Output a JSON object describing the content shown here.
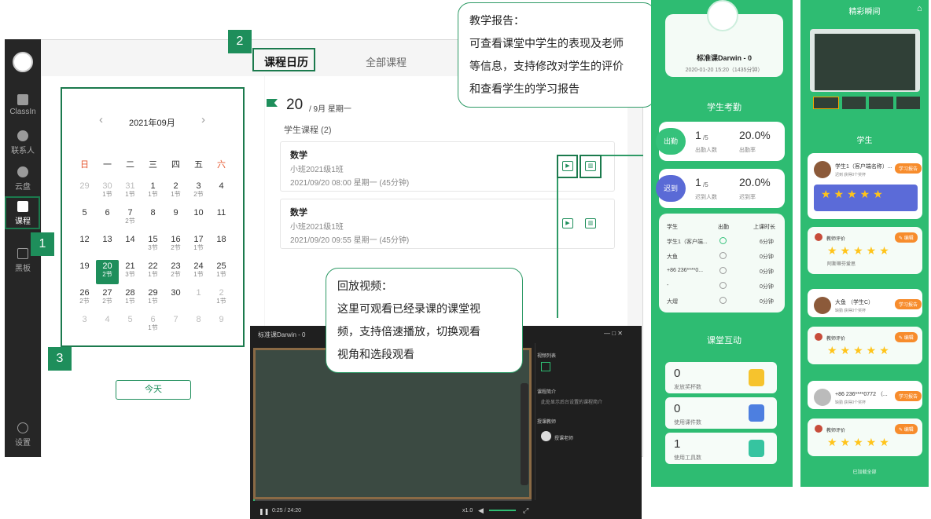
{
  "app": {
    "side": {
      "classin": "ClassIn",
      "contacts": "联系人",
      "cloud": "云盘",
      "course": "课程",
      "board": "黑板",
      "settings": "设置"
    },
    "tabs": {
      "calendar": "课程日历",
      "all": "全部课程"
    },
    "month": "2021年09月",
    "prev": "‹",
    "next": "›",
    "weekdays": [
      "日",
      "一",
      "二",
      "三",
      "四",
      "五",
      "六"
    ],
    "days": [
      [
        {
          "d": "29",
          "s": "",
          "m": true
        },
        {
          "d": "30",
          "s": "1节",
          "m": true
        },
        {
          "d": "31",
          "s": "1节",
          "m": true
        },
        {
          "d": "1",
          "s": "1节"
        },
        {
          "d": "2",
          "s": "1节"
        },
        {
          "d": "3",
          "s": "2节"
        },
        {
          "d": "4",
          "s": ""
        }
      ],
      [
        {
          "d": "5",
          "s": ""
        },
        {
          "d": "6",
          "s": ""
        },
        {
          "d": "7",
          "s": "2节"
        },
        {
          "d": "8",
          "s": ""
        },
        {
          "d": "9",
          "s": ""
        },
        {
          "d": "10",
          "s": ""
        },
        {
          "d": "11",
          "s": ""
        }
      ],
      [
        {
          "d": "12",
          "s": ""
        },
        {
          "d": "13",
          "s": ""
        },
        {
          "d": "14",
          "s": ""
        },
        {
          "d": "15",
          "s": "3节"
        },
        {
          "d": "16",
          "s": "2节"
        },
        {
          "d": "17",
          "s": "1节"
        },
        {
          "d": "18",
          "s": ""
        }
      ],
      [
        {
          "d": "19",
          "s": ""
        },
        {
          "d": "20",
          "s": "2节",
          "t": true
        },
        {
          "d": "21",
          "s": "3节"
        },
        {
          "d": "22",
          "s": "1节"
        },
        {
          "d": "23",
          "s": "2节"
        },
        {
          "d": "24",
          "s": "1节"
        },
        {
          "d": "25",
          "s": "1节"
        }
      ],
      [
        {
          "d": "26",
          "s": "2节"
        },
        {
          "d": "27",
          "s": "2节"
        },
        {
          "d": "28",
          "s": "1节"
        },
        {
          "d": "29",
          "s": "1节"
        },
        {
          "d": "30",
          "s": ""
        },
        {
          "d": "1",
          "s": "",
          "m": true
        },
        {
          "d": "2",
          "s": "1节",
          "m": true
        }
      ],
      [
        {
          "d": "3",
          "s": "",
          "m": true
        },
        {
          "d": "4",
          "s": "",
          "m": true
        },
        {
          "d": "5",
          "s": "",
          "m": true
        },
        {
          "d": "6",
          "s": "1节",
          "m": true
        },
        {
          "d": "7",
          "s": "",
          "m": true
        },
        {
          "d": "8",
          "s": "",
          "m": true
        },
        {
          "d": "9",
          "s": "",
          "m": true
        }
      ]
    ],
    "today_btn": "今天",
    "date_big": "20",
    "date_small": "/ 9月 星期一",
    "student_courses": "学生课程 (2)",
    "cards": [
      {
        "title": "数学",
        "cls": "小班2021级1班",
        "time": "2021/09/20 08:00 星期一 (45分钟)"
      },
      {
        "title": "数学",
        "cls": "小班2021级1班",
        "time": "2021/09/20 09:55 星期一 (45分钟)"
      }
    ]
  },
  "callouts": {
    "n1": "1",
    "n2": "2",
    "n3": "3",
    "report": [
      "教学报告：",
      "可查看课堂中学生的表现及老师",
      "等信息，支持修改对学生的评价",
      "和查看学生的学习报告"
    ],
    "replay": [
      "回放视频：",
      "这里可观看已经录课的课堂视",
      "频，支持倍速播放，切换观看",
      "视角和选段观看"
    ]
  },
  "player": {
    "title": "标准课Darwin - 0",
    "win": "—  □  ✕",
    "video_list": "视频列表",
    "intro_title": "课程简介",
    "intro": "此处显示后台设置的课程简介",
    "teacher_title": "授课教师",
    "teacher": "授课老师",
    "time": "0:25 / 24:20",
    "speed": "x1.0"
  },
  "phone1": {
    "title": "标准课Darwin - 0",
    "sub": "2020-01-20 15:20（1435分钟）",
    "attend": "学生考勤",
    "rows": [
      {
        "tag": "出勤",
        "n": "1",
        "d": "/5",
        "nl": "出勤人数",
        "p": "20.0%",
        "pl": "出勤率"
      },
      {
        "tag": "迟到",
        "n": "1",
        "d": "/5",
        "nl": "迟到人数",
        "p": "20.0%",
        "pl": "迟到率"
      }
    ],
    "th": [
      "学生",
      "出勤",
      "上课时长"
    ],
    "table": [
      [
        "学生1（客户端...",
        "6分钟"
      ],
      [
        "大鱼",
        "0分钟"
      ],
      [
        "+86 236****0...",
        "0分钟"
      ],
      [
        "-",
        "0分钟"
      ],
      [
        "大熠",
        "0分钟"
      ]
    ],
    "interact": "课堂互动",
    "stats": [
      {
        "v": "0",
        "l": "发放奖杯数"
      },
      {
        "v": "0",
        "l": "使用课件数"
      },
      {
        "v": "1",
        "l": "使用工具数"
      }
    ]
  },
  "phone2": {
    "moments": "精彩瞬间",
    "students": "学生",
    "list": [
      {
        "name": "学生1（客户端名称）...",
        "sub": "迟到  获得0个奖杯",
        "comment": "阿斯蒂芬爱思"
      },
      {
        "name": "大鱼 （学生C）",
        "sub": "缺勤  获得0个奖杯",
        "comment": ""
      },
      {
        "name": "+86 236****0772 （...",
        "sub": "缺勤  获得0个奖杯",
        "comment": ""
      }
    ],
    "report_btn": "学习报告",
    "eval": "教师评价",
    "edit": "✎ 编辑",
    "stars": "★★★★★",
    "loaded": "已加载全部"
  }
}
